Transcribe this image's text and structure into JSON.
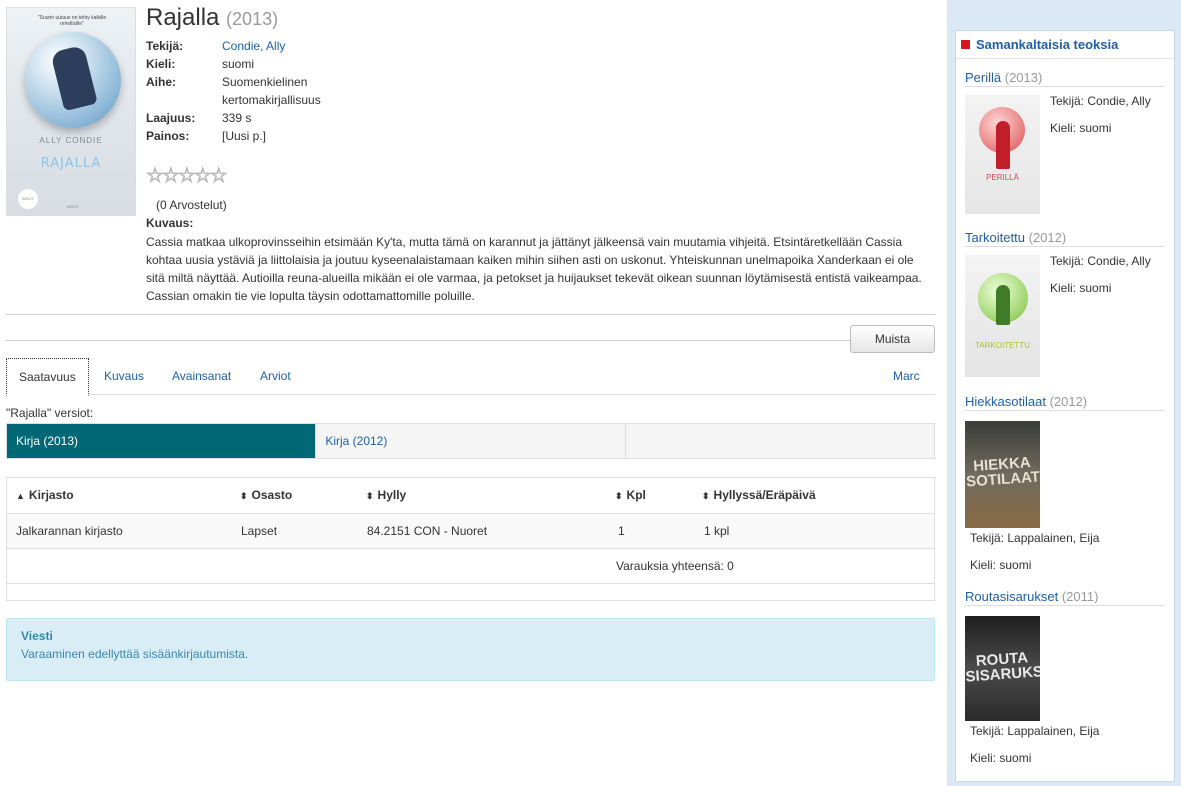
{
  "book": {
    "title": "Rajalla",
    "year": "(2013)",
    "cover": {
      "blurb": "\"Suurin uutuus on tehty kaikille rehellisille\"",
      "author": "ALLY CONDIE",
      "title": "RAJALLA",
      "logo": "WSOY",
      "publisher": "WSOY"
    },
    "meta": [
      {
        "key": "Tekijä:",
        "value": "Condie, Ally",
        "link": true
      },
      {
        "key": "Kieli:",
        "value": "suomi",
        "link": false
      },
      {
        "key": "Aihe:",
        "value": "Suomenkielinen kertomakirjallisuus",
        "link": false
      },
      {
        "key": "Laajuus:",
        "value": "339 s",
        "link": false
      },
      {
        "key": "Painos:",
        "value": "[Uusi p.]",
        "link": false
      }
    ],
    "stars": "☆☆☆☆☆",
    "ratings": "(0 Arvostelut)",
    "description_label": "Kuvaus:",
    "description": "Cassia matkaa ulkoprovinsseihin etsimään Ky'ta, mutta tämä on karannut ja jättänyt jälkeensä vain muutamia vihjeitä. Etsintäretkellään Cassia kohtaa uusia ystäviä ja liittolaisia ja joutuu kyseenalaistamaan kaiken mihin siihen asti on uskonut. Yhteiskunnan unelmapoika Xanderkaan ei ole sitä miltä näyttää. Autioilla reuna-alueilla mikään ei ole varmaa, ja petokset ja huijaukset tekevät oikean suunnan löytämisestä entistä vaikeampaa. Cassian omakin tie vie lopulta täysin odottamattomille poluille."
  },
  "buttons": {
    "muista": "Muista"
  },
  "tabs": [
    {
      "label": "Saatavuus",
      "active": true
    },
    {
      "label": "Kuvaus"
    },
    {
      "label": "Avainsanat"
    },
    {
      "label": "Arviot"
    },
    {
      "label": "Marc"
    }
  ],
  "versions": {
    "label": "\"Rajalla\" versiot:",
    "items": [
      {
        "label": "Kirja (2013)",
        "active": true
      },
      {
        "label": "Kirja (2012)"
      },
      {
        "label": ""
      }
    ]
  },
  "holdings": {
    "columns": [
      "Kirjasto",
      "Osasto",
      "Hylly",
      "Kpl",
      "Hyllyssä/Eräpäivä"
    ],
    "sort_icons": [
      "▲",
      "⬍",
      "⬍",
      "⬍",
      "⬍"
    ],
    "rows": [
      [
        "Jalkarannan kirjasto",
        "Lapset",
        "84.2151 CON - Nuoret",
        "1",
        "1 kpl"
      ]
    ],
    "reservations": "Varauksia yhteensä: 0"
  },
  "alert": {
    "title": "Viesti",
    "message": "Varaaminen edellyttää sisäänkirjautumista."
  },
  "sidebar": {
    "title": "Samankaltaisia teoksia",
    "items": [
      {
        "title": "Perillä",
        "year": "(2013)",
        "author": "Tekijä: Condie, Ally",
        "language": "Kieli: suomi",
        "cover_text": "PERILLÄ"
      },
      {
        "title": "Tarkoitettu",
        "year": "(2012)",
        "author": "Tekijä: Condie, Ally",
        "language": "Kieli: suomi",
        "cover_text": "TARKOITETTU"
      },
      {
        "title": "Hiekkasotilaat",
        "year": "(2012)",
        "author": "Tekijä: Lappalainen, Eija",
        "language": "Kieli: suomi",
        "cover_text": "HIEKKA SOTILAAT"
      },
      {
        "title": "Routasisarukset",
        "year": "(2011)",
        "author": "Tekijä: Lappalainen, Eija",
        "language": "Kieli: suomi",
        "cover_text": "ROUTA SISARUKSET"
      }
    ]
  },
  "colors": {
    "link": "#1f5fa8",
    "active_version": "#006775",
    "alert_bg": "#d9edf7",
    "sidebar_bg": "#dbe9f6",
    "sidebar_marker": "#d9151e"
  }
}
